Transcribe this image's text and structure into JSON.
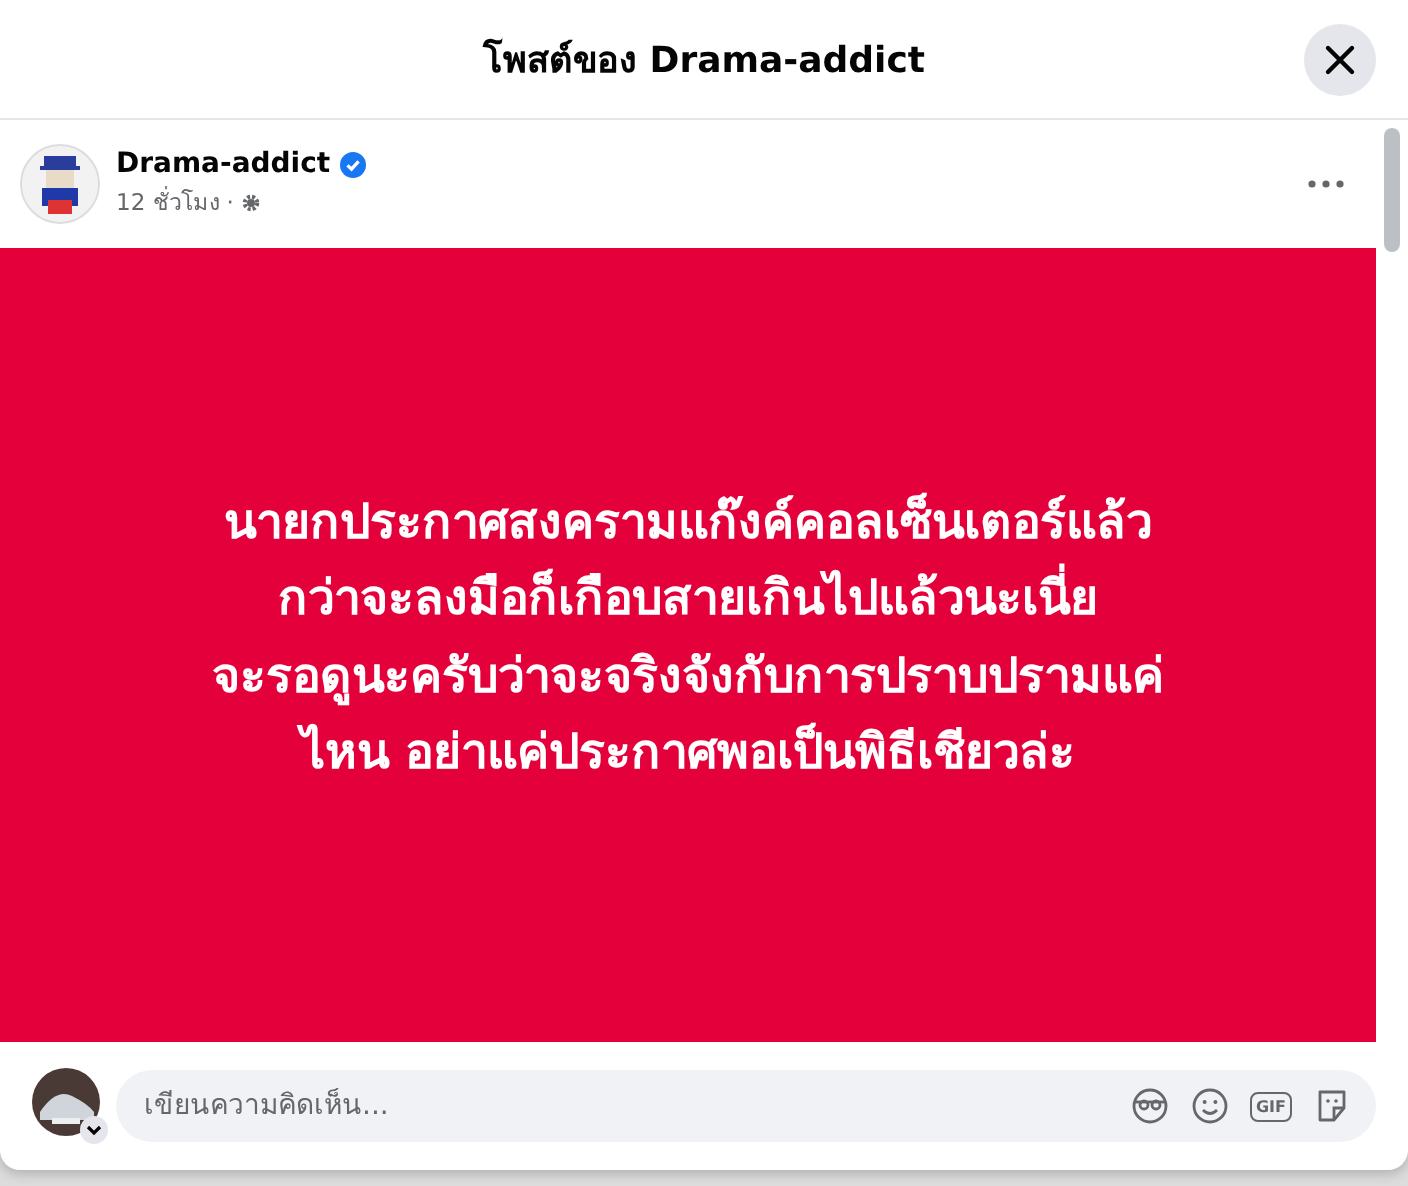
{
  "dialog": {
    "title": "โพสต์ของ Drama-addict"
  },
  "post": {
    "author": "Drama-addict",
    "verified": true,
    "time": "12 ชั่วโมง",
    "separator": "·",
    "lines": [
      "นายกประกาศสงครามแก๊งค์คอลเซ็นเตอร์แล้ว",
      "กว่าจะลงมือก็เกือบสายเกินไปแล้วนะเนี่ย",
      "จะรอดูนะครับว่าจะจริงจังกับการปราบปรามแค่",
      "ไหน อย่าแค่ประกาศพอเป็นพิธีเชียวล่ะ"
    ]
  },
  "comment": {
    "placeholder": "เขียนความคิดเห็น...",
    "gif_label": "GIF"
  }
}
